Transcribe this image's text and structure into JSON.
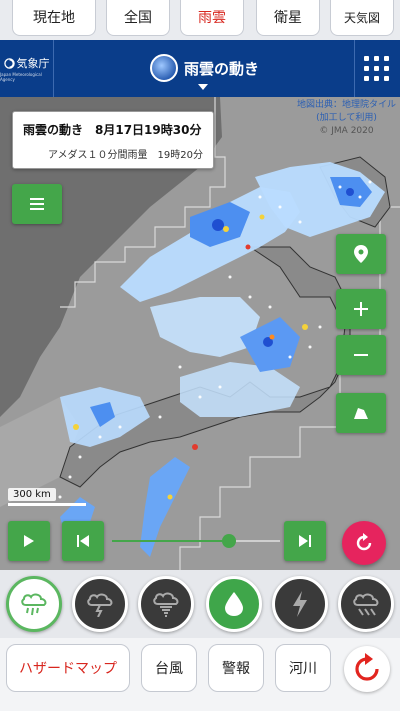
{
  "top_tabs": [
    {
      "label": "現在地",
      "active": false
    },
    {
      "label": "全国",
      "active": false
    },
    {
      "label": "雨雲",
      "active": true
    },
    {
      "label": "衛星",
      "active": false
    },
    {
      "label": "天気図",
      "active": false
    }
  ],
  "header": {
    "logo_text": "気象庁",
    "logo_sub": "Japan Meteorological Agency",
    "title": "雨雲の動き"
  },
  "map": {
    "credit_line1": "地図出典：地理院タイル",
    "credit_line2": "(加工して利用)",
    "credit_line3": "© JMA 2020",
    "info_title": "雨雲の動き　8月17日19時30分",
    "info_sub": "アメダス１０分間雨量　19時20分",
    "scale": "300 km",
    "slider_position": 0.73
  },
  "weather_types": [
    "rain-cloud-icon",
    "thunder-cloud-icon",
    "tornado-cloud-icon",
    "raindrop-icon",
    "lightning-icon",
    "snow-cloud-icon"
  ],
  "bottom": {
    "hazard_map": "ハザードマップ",
    "typhoon": "台風",
    "warning": "警報",
    "river": "河川"
  },
  "colors": {
    "header_blue": "#0a3d8a",
    "accent_green": "#44a64a",
    "active_red": "#d8261e",
    "reload_pink": "#e6245e"
  }
}
